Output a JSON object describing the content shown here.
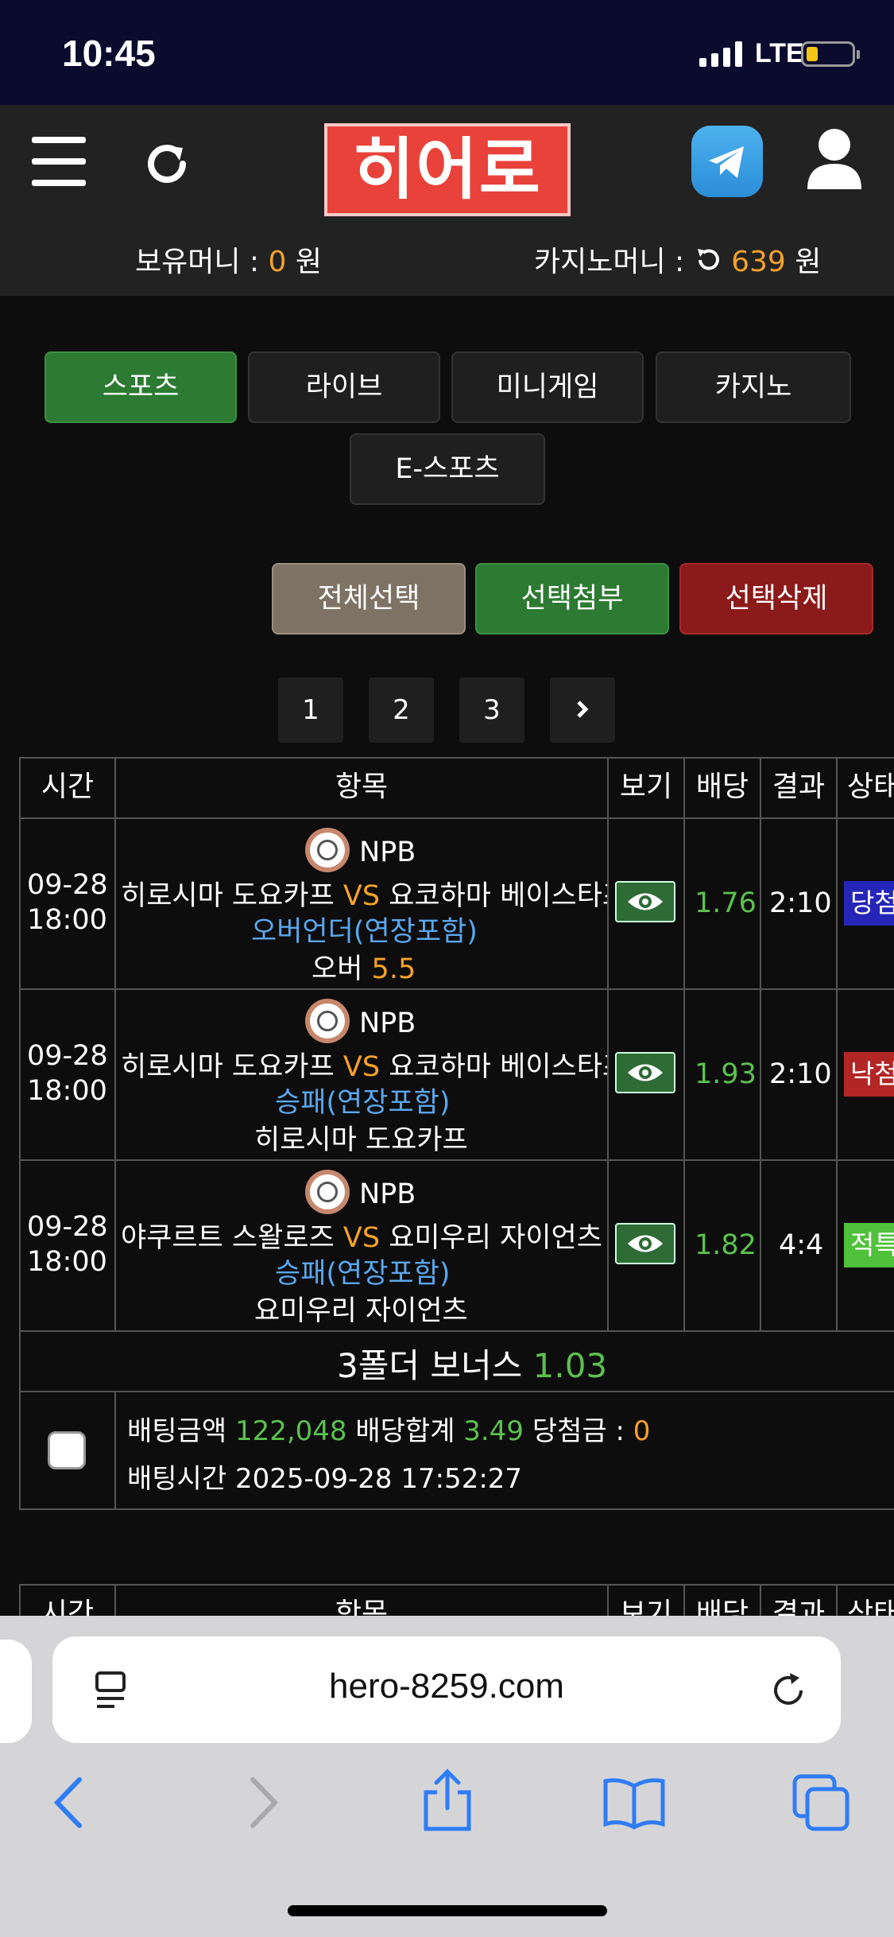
{
  "status_bar": {
    "time": "10:45",
    "network": "LTE",
    "battery_color": "#f5c518"
  },
  "header": {
    "menu_icon": "hamburger-icon",
    "refresh_icon": "refresh-icon",
    "logo_text": "히어로",
    "telegram_icon": "telegram-icon",
    "user_icon": "user-icon",
    "held_money_label": "보유머니 :",
    "held_money_value": "0",
    "held_money_unit": "원",
    "casino_money_label": "카지노머니 :",
    "casino_money_value": "639",
    "casino_money_unit": "원"
  },
  "tabs": [
    "스포츠",
    "라이브",
    "미니게임",
    "카지노",
    "E-스포츠"
  ],
  "actions": {
    "select_all": "전체선택",
    "attach_selected": "선택첨부",
    "delete_selected": "선택삭제"
  },
  "pagination": {
    "pages": [
      "1",
      "2",
      "3"
    ],
    "next_icon": "chevron-right-icon"
  },
  "table_headers": [
    "시간",
    "항목",
    "보기",
    "배당",
    "결과",
    "상태"
  ],
  "bets": [
    {
      "date": "09-28",
      "time": "18:00",
      "league": "NPB",
      "home": "히로시마 도요카프",
      "vs": "VS",
      "away": "요코하마 베이스타즈",
      "market": "오버언더(연장포함)",
      "pick": "오버",
      "pick_value": "5.5",
      "odds": "1.76",
      "result": "2:10",
      "status": "당첨",
      "status_color": "#2525b8"
    },
    {
      "date": "09-28",
      "time": "18:00",
      "league": "NPB",
      "home": "히로시마 도요카프",
      "vs": "VS",
      "away": "요코하마 베이스타즈",
      "market": "승패(연장포함)",
      "pick": "히로시마 도요카프",
      "pick_value": "",
      "odds": "1.93",
      "result": "2:10",
      "status": "낙첨",
      "status_color": "#b32626"
    },
    {
      "date": "09-28",
      "time": "18:00",
      "league": "NPB",
      "home": "야쿠르트 스왈로즈",
      "vs": "VS",
      "away": "요미우리 자이언츠",
      "market": "승패(연장포함)",
      "pick": "요미우리 자이언츠",
      "pick_value": "",
      "odds": "1.82",
      "result": "4:4",
      "status": "적특",
      "status_color": "#4fc13a"
    }
  ],
  "bonus": {
    "label": "3폴더 보너스",
    "value": "1.03"
  },
  "summary": {
    "bet_amount_label": "배팅금액",
    "bet_amount": "122,048",
    "odds_total_label": "배당합계",
    "odds_total": "3.49",
    "win_label": "당첨금 :",
    "win_amount": "0",
    "bet_time_label": "배팅시간",
    "bet_time": "2025-09-28 17:52:27"
  },
  "next_table_headers": [
    "시간",
    "항목",
    "보기",
    "배당",
    "결과",
    "상태"
  ],
  "browser": {
    "url": "hero-8259.com",
    "reader_icon": "reader-icon",
    "reload_icon": "reload-icon",
    "nav_icons": [
      "back-icon",
      "forward-icon",
      "share-icon",
      "bookmarks-icon",
      "tabs-icon"
    ]
  }
}
